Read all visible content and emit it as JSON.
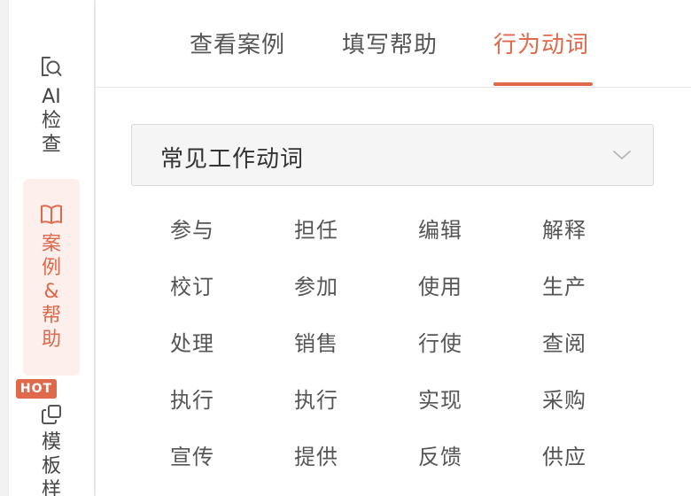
{
  "rail": {
    "ai": {
      "icon": "ai-check-icon",
      "lines": [
        "AI",
        "检",
        "查"
      ]
    },
    "cases": {
      "icon": "book-icon",
      "lines": [
        "案",
        "例",
        "&",
        "帮",
        "助"
      ]
    },
    "templates": {
      "icon": "template-copy-icon",
      "badge": "HOT",
      "lines": [
        "模",
        "板",
        "样"
      ]
    }
  },
  "tabs": [
    {
      "label": "查看案例"
    },
    {
      "label": "填写帮助"
    },
    {
      "label": "行为动词"
    }
  ],
  "select": {
    "value": "常见工作动词",
    "icon": "chevron-down-icon"
  },
  "verbs": [
    "参与",
    "担任",
    "编辑",
    "解释",
    "校订",
    "参加",
    "使用",
    "生产",
    "处理",
    "销售",
    "行使",
    "查阅",
    "执行",
    "执行",
    "实现",
    "采购",
    "宣传",
    "提供",
    "反馈",
    "供应"
  ],
  "colors": {
    "accent": "#e0684b",
    "accent_bg": "#fdf0ec",
    "text": "#555555"
  }
}
